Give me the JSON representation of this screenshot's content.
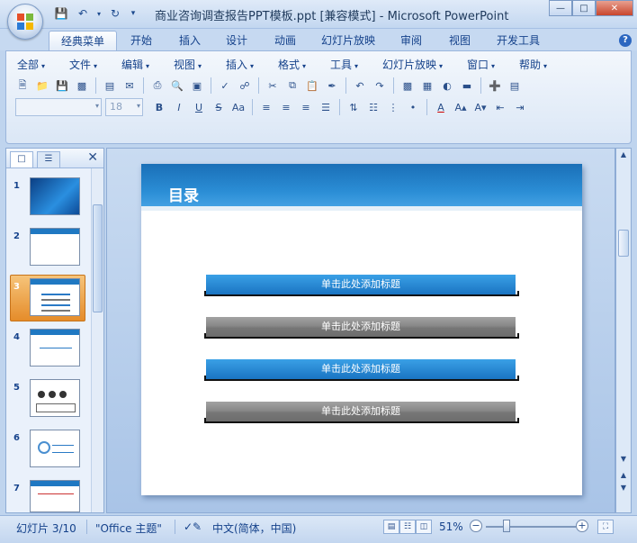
{
  "window": {
    "title": "商业咨询调查报告PPT模板.ppt [兼容模式] - Microsoft PowerPoint"
  },
  "ribbon_tabs": [
    "经典菜单",
    "开始",
    "插入",
    "设计",
    "动画",
    "幻灯片放映",
    "审阅",
    "视图",
    "开发工具"
  ],
  "menu_items": [
    "全部",
    "文件",
    "编辑",
    "视图",
    "插入",
    "格式",
    "工具",
    "幻灯片放映",
    "窗口",
    "帮助"
  ],
  "font_size": "18",
  "slides_panel": {
    "numbers": [
      "1",
      "2",
      "3",
      "4",
      "5",
      "6",
      "7"
    ],
    "selected": "3"
  },
  "slide": {
    "title": "目录",
    "bars": [
      "单击此处添加标题",
      "单击此处添加标题",
      "单击此处添加标题",
      "单击此处添加标题"
    ]
  },
  "status": {
    "slide_info": "幻灯片 3/10",
    "theme": "\"Office 主题\"",
    "language": "中文(简体，中国)",
    "zoom": "51%"
  },
  "colors": {
    "accent": "#1a74c2",
    "selection": "#e58c2a",
    "gray_bar": "#777777"
  }
}
